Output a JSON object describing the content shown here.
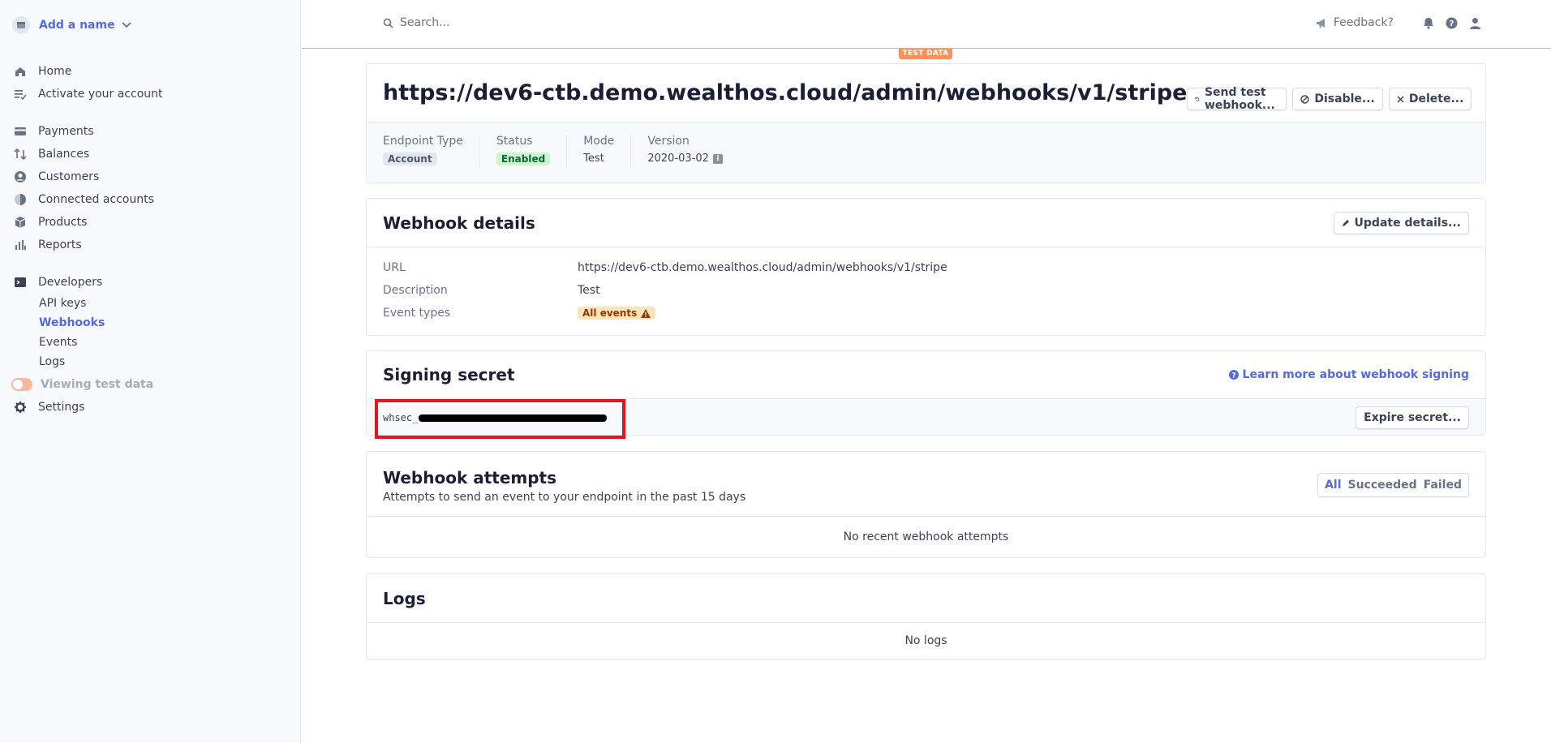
{
  "sidebar": {
    "account_name": "Add a name",
    "nav": [
      {
        "label": "Home",
        "icon": "home-icon"
      },
      {
        "label": "Activate your account",
        "icon": "checklist-icon"
      }
    ],
    "nav2": [
      {
        "label": "Payments",
        "icon": "payments-icon"
      },
      {
        "label": "Balances",
        "icon": "balances-icon"
      },
      {
        "label": "Customers",
        "icon": "customers-icon"
      },
      {
        "label": "Connected accounts",
        "icon": "connected-accounts-icon"
      },
      {
        "label": "Products",
        "icon": "products-icon"
      },
      {
        "label": "Reports",
        "icon": "reports-icon"
      }
    ],
    "developers": {
      "label": "Developers",
      "icon": "terminal-icon"
    },
    "dev_items": [
      "API keys",
      "Webhooks",
      "Events",
      "Logs"
    ],
    "active_dev_item": "Webhooks",
    "test_toggle_label": "Viewing test data",
    "settings_label": "Settings"
  },
  "topbar": {
    "search_placeholder": "Search...",
    "feedback_label": "Feedback?",
    "test_badge": "TEST DATA"
  },
  "endpoint": {
    "url_title": "https://dev6-ctb.demo.wealthos.cloud/admin/webhooks/v1/stripe",
    "send_test_label": "Send test webhook...",
    "disable_label": "Disable...",
    "delete_label": "Delete...",
    "meta": {
      "endpoint_type_label": "Endpoint Type",
      "endpoint_type_value": "Account",
      "status_label": "Status",
      "status_value": "Enabled",
      "mode_label": "Mode",
      "mode_value": "Test",
      "version_label": "Version",
      "version_value": "2020-03-02"
    }
  },
  "details": {
    "title": "Webhook details",
    "update_label": "Update details...",
    "url_label": "URL",
    "url_value": "https://dev6-ctb.demo.wealthos.cloud/admin/webhooks/v1/stripe",
    "description_label": "Description",
    "description_value": "Test",
    "event_types_label": "Event types",
    "event_types_value": "All events"
  },
  "secret": {
    "title": "Signing secret",
    "learn_more": "Learn more about webhook signing",
    "secret_prefix": "whsec_",
    "expire_label": "Expire secret..."
  },
  "attempts": {
    "title": "Webhook attempts",
    "subtitle": "Attempts to send an event to your endpoint in the past 15 days",
    "filters": [
      "All",
      "Succeeded",
      "Failed"
    ],
    "active_filter": "All",
    "empty": "No recent webhook attempts"
  },
  "logs": {
    "title": "Logs",
    "empty": "No logs"
  },
  "colors": {
    "accent": "#556cd6",
    "test_orange": "#f5925e",
    "highlight_red": "#e0161f"
  }
}
